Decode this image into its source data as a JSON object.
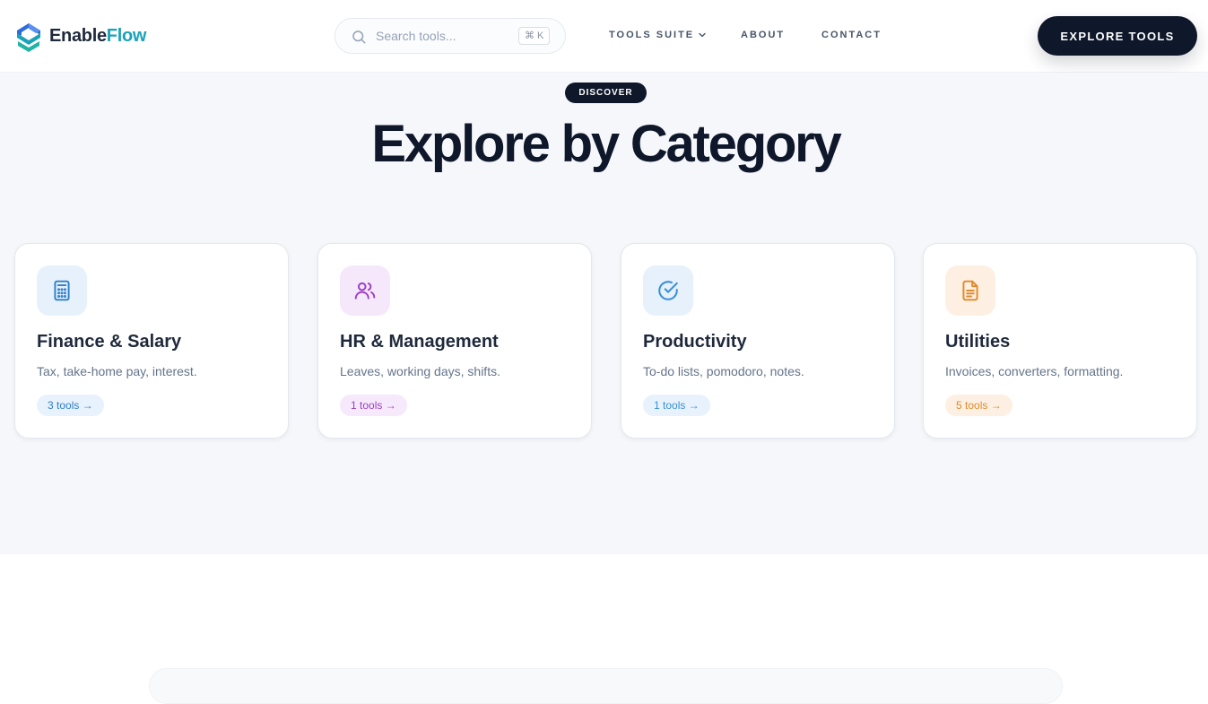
{
  "brand": {
    "name_part1": "Enable",
    "name_part2": "Flow",
    "colors": {
      "dark": "#1e293b",
      "accent": "#1aa3b8"
    }
  },
  "search": {
    "placeholder": "Search tools...",
    "shortcut": "⌘ K"
  },
  "nav": {
    "items": [
      {
        "label": "TOOLS SUITE",
        "has_dropdown": true
      },
      {
        "label": "ABOUT"
      },
      {
        "label": "CONTACT"
      }
    ],
    "cta_label": "EXPLORE TOOLS"
  },
  "category_section": {
    "badge": "DISCOVER",
    "title": "Explore by Category",
    "cards": [
      {
        "title": "Finance & Salary",
        "description": "Tax, take-home pay, interest.",
        "tools_label": "3 tools →",
        "icon": "calculator-icon",
        "color": "#2f80c9",
        "icon_bg": "#e6f1fb",
        "pill_bg": "#e8f2fc"
      },
      {
        "title": "HR & Management",
        "description": "Leaves, working days, shifts.",
        "tools_label": "1 tools →",
        "icon": "users-icon",
        "color": "#9b3fc4",
        "icon_bg": "#f6e8fb",
        "pill_bg": "#f6e9fb"
      },
      {
        "title": "Productivity",
        "description": "To-do lists, pomodoro, notes.",
        "tools_label": "1 tools →",
        "icon": "check-circle-icon",
        "color": "#3a90d8",
        "icon_bg": "#e6f1fb",
        "pill_bg": "#e8f2fc"
      },
      {
        "title": "Utilities",
        "description": "Invoices, converters, formatting.",
        "tools_label": "5 tools →",
        "icon": "document-icon",
        "color": "#e08a2c",
        "icon_bg": "#fdf0e2",
        "pill_bg": "#fdf0e3"
      }
    ]
  }
}
